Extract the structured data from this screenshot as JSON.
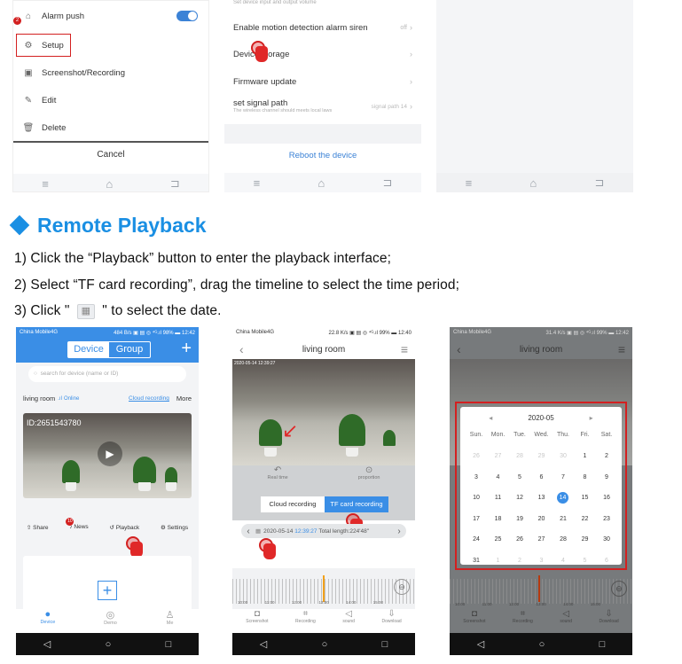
{
  "top_panels": {
    "panel1": {
      "items": [
        {
          "label": "Alarm push",
          "icon": "bell-icon"
        },
        {
          "label": "Setup",
          "icon": "gear-icon"
        },
        {
          "label": "Screenshot/Recording",
          "icon": "image-icon"
        },
        {
          "label": "Edit",
          "icon": "pencil-icon"
        },
        {
          "label": "Delete",
          "icon": "trash-icon"
        }
      ],
      "badge": "2",
      "cancel": "Cancel"
    },
    "panel2": {
      "top_note": "Set device input and output volume",
      "rows": [
        {
          "label": "Enable motion detection alarm siren",
          "value": "off"
        },
        {
          "label": "Device storage",
          "value": ""
        },
        {
          "label": "Firmware update",
          "value": ""
        },
        {
          "label": "set signal path",
          "sub": "The wireless channel should meets local laws",
          "value": "signal path 14"
        }
      ],
      "reboot": "Reboot the device"
    }
  },
  "section": {
    "title": "Remote Playback",
    "accent": "#1a8fe3",
    "steps": [
      "1) Click the “Playback” button to enter the playback interface;",
      "2) Select “TF card recording”, drag the timeline to select the time period;",
      "3) Click \" ",
      " \" to select the date."
    ]
  },
  "phone1": {
    "status_left": "China Mobile4G",
    "status_right": "484 B/s ▣ ▤ ◎ ⁴ᴳ.ıl 98% ▬ 12:42",
    "tab_device": "Device",
    "tab_group": "Group",
    "search_placeholder": "search for device (name or ID)",
    "device_name": "living room",
    "online": "Online",
    "cloud": "Cloud recording",
    "more": "More",
    "cam_id": "ID:2651543780",
    "actions": [
      "Share",
      "News",
      "Playback",
      "Settings"
    ],
    "news_badge": "10",
    "bottom_tabs": [
      "Device",
      "Demo",
      "Me"
    ]
  },
  "phone2": {
    "status_left": "China Mobile4G",
    "status_right": "22.8 K/s ▣ ▤ ◎ ⁴ᴳ.ıl 99% ▬ 12:40",
    "title": "living room",
    "cam_stamp": "2020-05-14 12:39:27",
    "left_label": "Real time",
    "right_label": "proportion",
    "tab_cloud": "Cloud recording",
    "tab_tf": "TF card recording",
    "date_plain": "2020-05-14",
    "date_time": "12:39:27",
    "total": "Total length:224'48\"",
    "ticks": [
      "10:00",
      "11:00",
      "12:00",
      "13:00",
      "14:00",
      "15:00"
    ],
    "tools": [
      "Screenshot",
      "Recording",
      "sound",
      "Download"
    ]
  },
  "phone3": {
    "status_left": "China Mobile4G",
    "status_right": "31.4 K/s ▣ ▤ ◎ ⁴ᴳ.ıl 99% ▬ 12:42",
    "title": "living room",
    "month": "2020-05",
    "weekdays": [
      "Sun.",
      "Mon.",
      "Tue.",
      "Wed.",
      "Thu.",
      "Fri.",
      "Sat."
    ],
    "days": [
      [
        "26",
        "27",
        "28",
        "29",
        "30",
        "1",
        "2"
      ],
      [
        "3",
        "4",
        "5",
        "6",
        "7",
        "8",
        "9"
      ],
      [
        "10",
        "11",
        "12",
        "13",
        "14",
        "15",
        "16"
      ],
      [
        "17",
        "18",
        "19",
        "20",
        "21",
        "22",
        "23"
      ],
      [
        "24",
        "25",
        "26",
        "27",
        "28",
        "29",
        "30"
      ],
      [
        "31",
        "1",
        "2",
        "3",
        "4",
        "5",
        "6"
      ]
    ],
    "selected": "14",
    "ticks": [
      "10:00",
      "11:00",
      "12:00",
      "13:00",
      "14:00",
      "15:00"
    ],
    "tools": [
      "Screenshot",
      "Recording",
      "sound",
      "Download"
    ]
  }
}
